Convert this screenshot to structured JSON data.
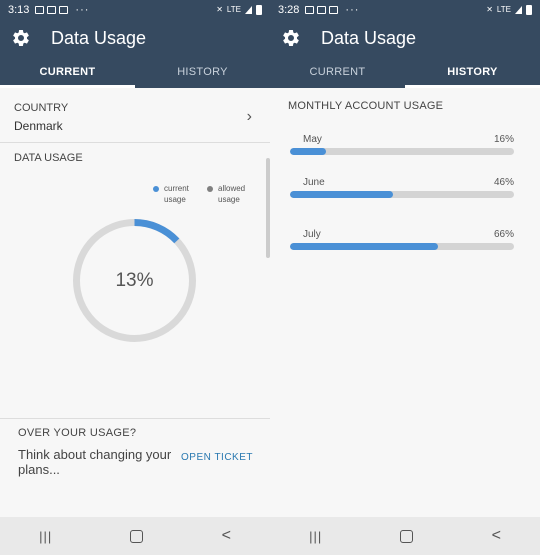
{
  "colors": {
    "header": "#364a60",
    "accent": "#4a90d6",
    "track": "#d4d4d4",
    "link": "#2878b0"
  },
  "left": {
    "status": {
      "time": "3:13",
      "network": "LTE"
    },
    "app_title": "Data Usage",
    "tabs": [
      {
        "label": "CURRENT",
        "active": true
      },
      {
        "label": "HISTORY",
        "active": false
      }
    ],
    "country": {
      "label": "COUNTRY",
      "value": "Denmark"
    },
    "data_usage": {
      "label": "DATA USAGE",
      "legend": [
        {
          "label": "current usage",
          "color": "#4a90d6"
        },
        {
          "label": "allowed usage",
          "color": "#808080"
        }
      ],
      "percent_value": 13,
      "percent_text": "13%"
    },
    "over_usage": {
      "title": "OVER YOUR USAGE?",
      "text": "Think about changing your plans...",
      "link_label": "OPEN TICKET"
    }
  },
  "right": {
    "status": {
      "time": "3:28",
      "network": "LTE"
    },
    "app_title": "Data Usage",
    "tabs": [
      {
        "label": "CURRENT",
        "active": false
      },
      {
        "label": "HISTORY",
        "active": true
      }
    ],
    "history": {
      "title": "MONTHLY ACCOUNT USAGE",
      "months": [
        {
          "name": "May",
          "percent_text": "16%",
          "value": 16
        },
        {
          "name": "June",
          "percent_text": "46%",
          "value": 46
        },
        {
          "name": "July",
          "percent_text": "66%",
          "value": 66
        }
      ]
    }
  },
  "nav_icons": [
    "recents-icon",
    "home-icon",
    "back-icon"
  ]
}
